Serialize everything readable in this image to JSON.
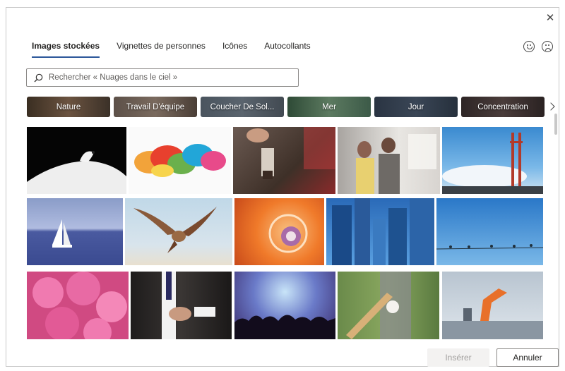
{
  "dialog": {
    "tabs": [
      {
        "label": "Images stockées",
        "active": true
      },
      {
        "label": "Vignettes de personnes",
        "active": false
      },
      {
        "label": "Icônes",
        "active": false
      },
      {
        "label": "Autocollants",
        "active": false
      }
    ],
    "feedback_icons": [
      "smile-icon",
      "frown-icon"
    ],
    "search": {
      "placeholder": "Rechercher « Nuages dans le ciel »",
      "value": ""
    },
    "categories": [
      {
        "label": "Nature",
        "color": "#4a3a2c"
      },
      {
        "label": "Travail D'équipe",
        "color": "#5a4a3e"
      },
      {
        "label": "Coucher De Sol...",
        "color": "#3c4650"
      },
      {
        "label": "Mer",
        "color": "#3d5a44"
      },
      {
        "label": "Jour",
        "color": "#2e3a48"
      },
      {
        "label": "Concentration",
        "color": "#3a3030"
      }
    ],
    "images": [
      {
        "name": "swan-image"
      },
      {
        "name": "colored-smoke-image"
      },
      {
        "name": "paintbrush-image"
      },
      {
        "name": "team-whiteboard-image"
      },
      {
        "name": "golden-gate-bridge-image"
      },
      {
        "name": "sailboat-image"
      },
      {
        "name": "flying-bird-image"
      },
      {
        "name": "nautilus-shell-image"
      },
      {
        "name": "city-buildings-image"
      },
      {
        "name": "birds-on-wire-image"
      },
      {
        "name": "pink-hydrangea-image"
      },
      {
        "name": "businessman-cufflinks-image"
      },
      {
        "name": "concert-crowd-image"
      },
      {
        "name": "baseball-bat-image"
      },
      {
        "name": "robot-factory-image"
      }
    ],
    "footer": {
      "insert_label": "Insérer",
      "cancel_label": "Annuler"
    }
  }
}
